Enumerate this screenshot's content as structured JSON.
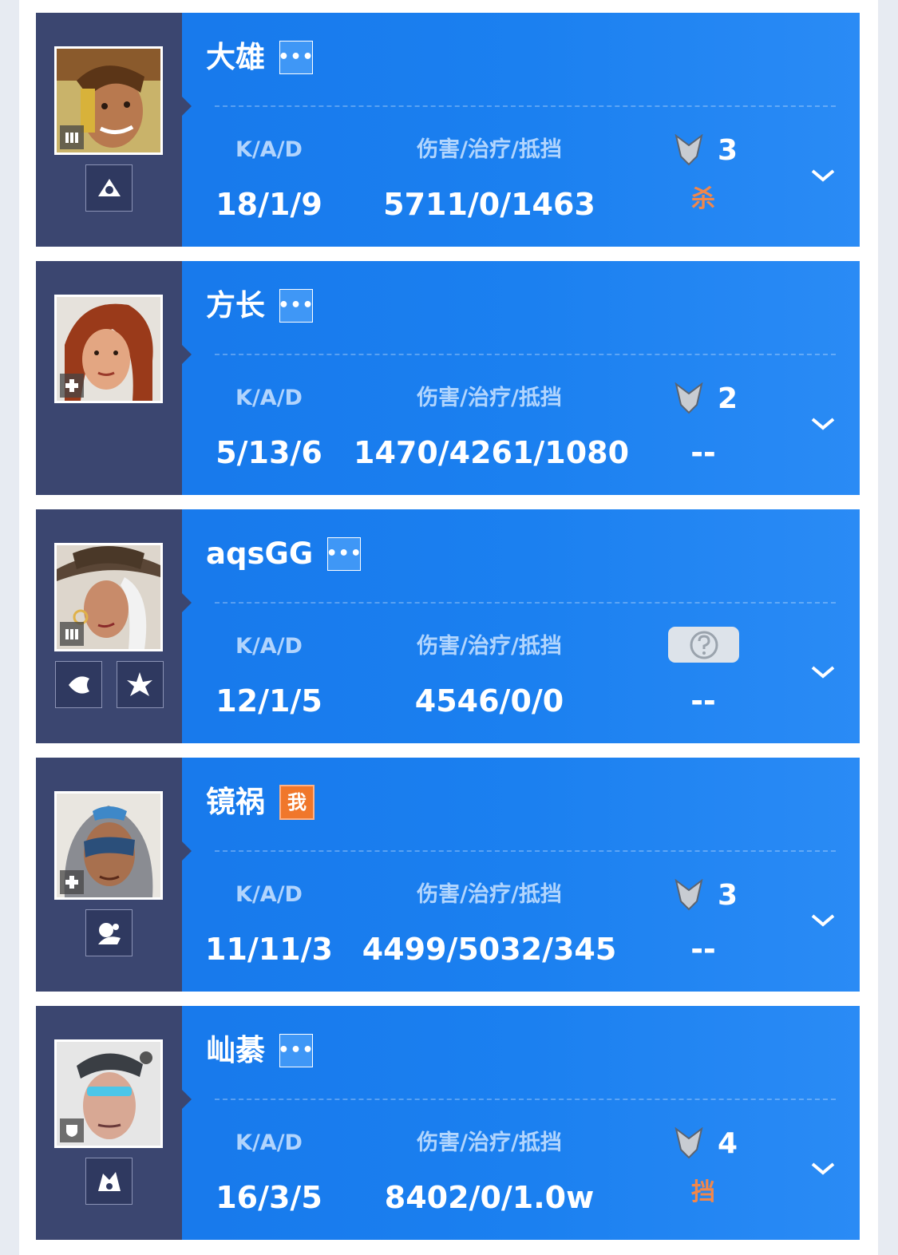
{
  "headers": {
    "kad": "K/A/D",
    "stats": "伤害/治疗/抵挡"
  },
  "players": [
    {
      "name": "大雄",
      "kad": "18/1/9",
      "stats": "5711/0/1463",
      "rank": "3",
      "tag": "杀",
      "badge": "more"
    },
    {
      "name": "方长",
      "kad": "5/13/6",
      "stats": "1470/4261/1080",
      "rank": "2",
      "tag": "--",
      "badge": "more"
    },
    {
      "name": "aqsGG",
      "kad": "12/1/5",
      "stats": "4546/0/0",
      "rank": "",
      "tag": "--",
      "badge": "more"
    },
    {
      "name": "镜祸",
      "kad": "11/11/3",
      "stats": "4499/5032/345",
      "rank": "3",
      "tag": "--",
      "badge": "me",
      "badge_text": "我"
    },
    {
      "name": "屾綦",
      "kad": "16/3/5",
      "stats": "8402/0/1.0w",
      "rank": "4",
      "tag": "挡",
      "badge": "more"
    }
  ],
  "more_icon_text": "•••",
  "colors": {
    "card": "#1b7ff0",
    "side": "#3b4670",
    "me_badge": "#f0772b",
    "tag": "#f2874a"
  }
}
